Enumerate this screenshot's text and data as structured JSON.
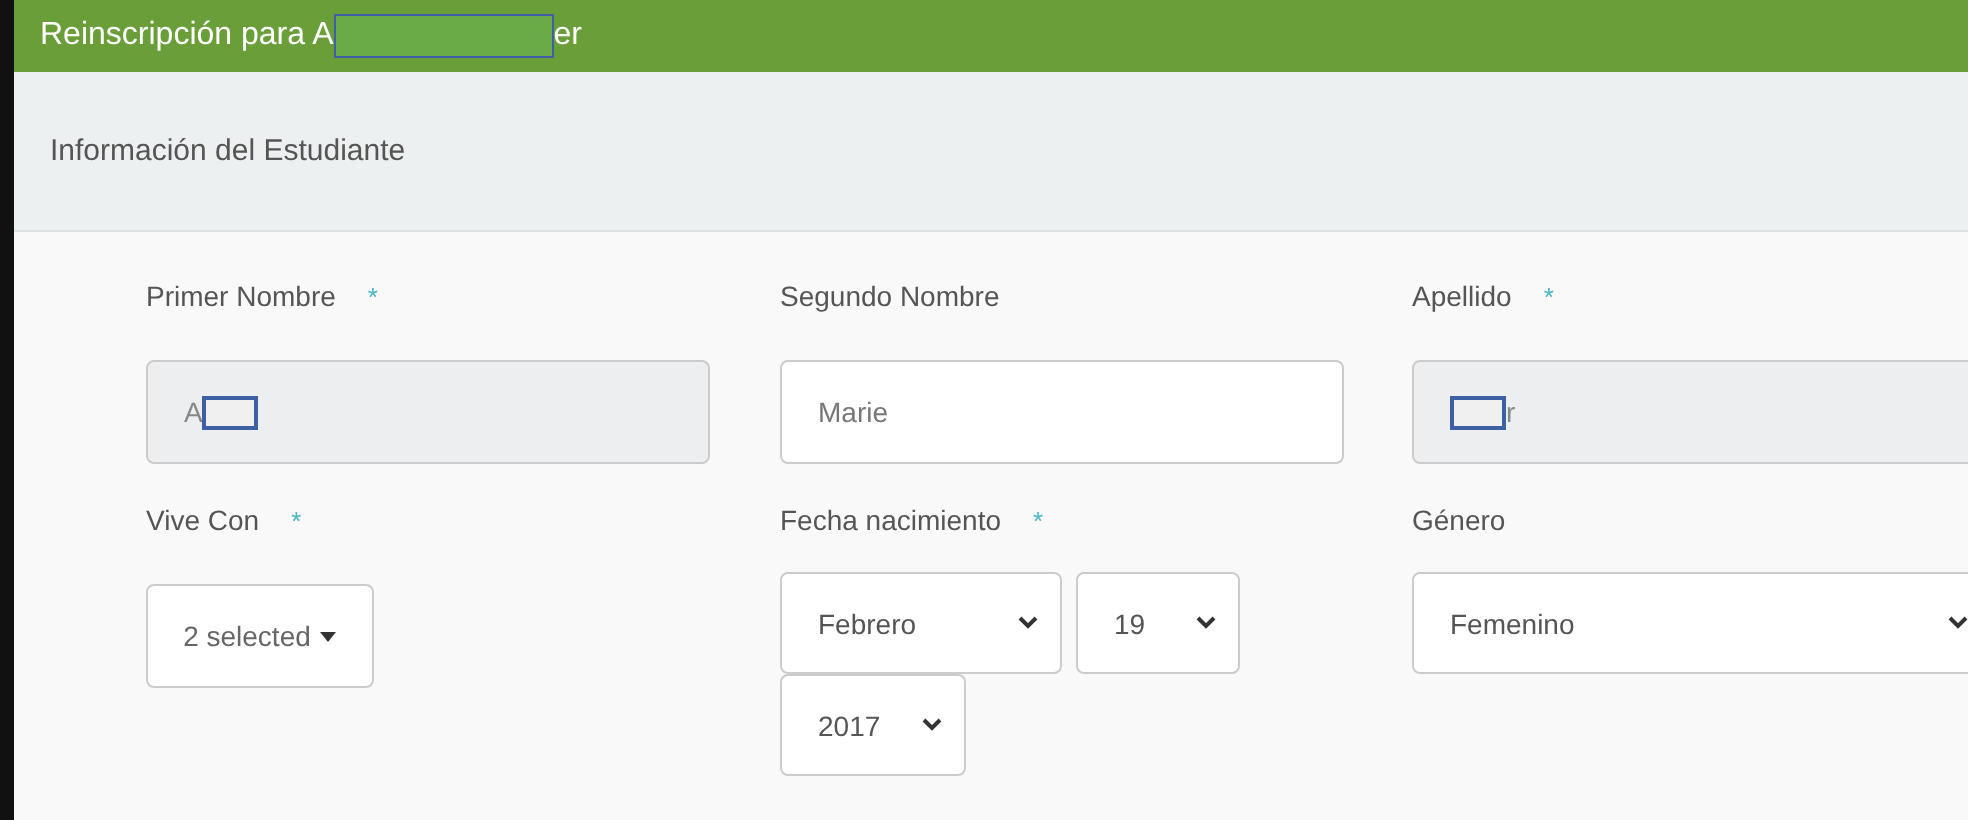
{
  "title": {
    "before": "Reinscripción para A",
    "redacted": true,
    "after": "er"
  },
  "section": {
    "title": "Información del Estudiante"
  },
  "fields": [
    {
      "label": "Primer Nombre",
      "required_mark": "*",
      "kind": "text",
      "disabled": true,
      "before": "A",
      "redacted": true
    },
    {
      "label": "Segundo Nombre",
      "kind": "text",
      "disabled": false,
      "before": "Marie",
      "redacted": false
    },
    {
      "label": "Apellido",
      "required_mark": "*",
      "kind": "text",
      "disabled": true,
      "redacted": true,
      "after": "r"
    },
    {
      "label": "Vive Con",
      "required_mark": "*",
      "kind": "multiselect",
      "value": "2 selected"
    },
    {
      "label": "Fecha nacimiento",
      "required_mark": "*",
      "kind": "date",
      "parts": [
        "Febrero",
        "19",
        "2017"
      ]
    },
    {
      "label": "Género",
      "kind": "select",
      "value": "Femenino"
    }
  ]
}
